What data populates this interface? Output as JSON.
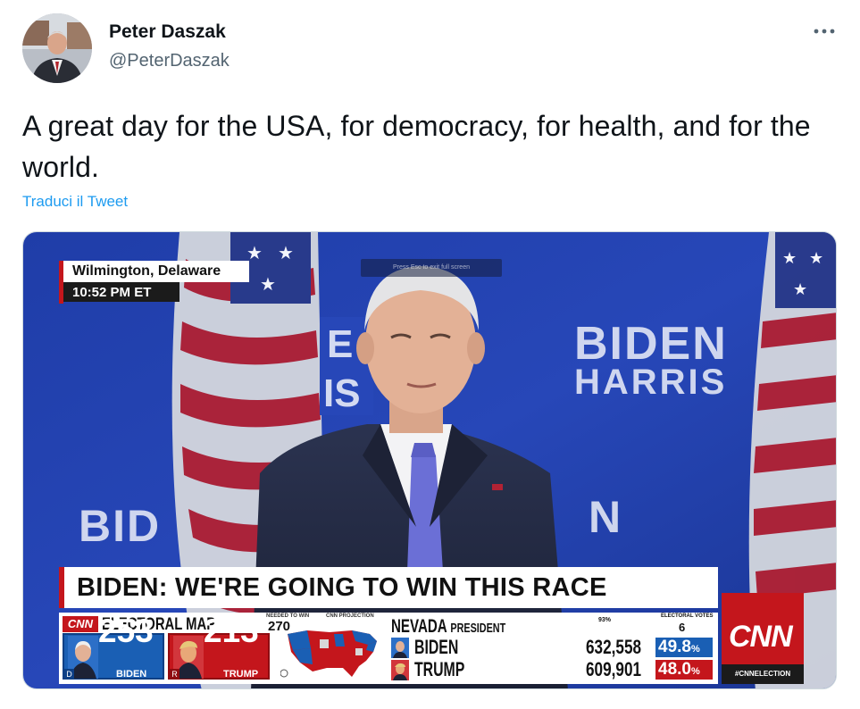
{
  "author": {
    "name": "Peter Daszak",
    "handle": "@PeterDaszak",
    "avatar_icon": "profile-photo"
  },
  "more_icon": "ellipsis-icon",
  "tweet": {
    "text": "A great day for the USA, for democracy, for health, and for the world.",
    "translate_label": "Traduci il Tweet"
  },
  "media": {
    "location": {
      "place": "Wilmington, Delaware",
      "time": "10:52 PM ET"
    },
    "backdrop": {
      "biden": "BIDEN",
      "harris": "HARRIS",
      "left_partial": "BID",
      "mid_partial": "N"
    },
    "ghost_hint": "Press Esc to exit full screen",
    "headline": "BIDEN: WE'RE GOING TO WIN THIS RACE",
    "electoral_map": {
      "brand": "CNN",
      "title": "ELECTORAL MAP",
      "needed_label": "NEEDED TO WIN",
      "needed_value": "270",
      "projection_label": "CNN PROJECTION",
      "biden_ev": "253",
      "trump_ev": "213",
      "biden_label": "BIDEN",
      "trump_label": "TRUMP",
      "party_d": "D",
      "party_r": "R"
    },
    "state_race": {
      "state": "NEVADA",
      "office": "PRESIDENT",
      "reporting": "93%",
      "ev_label": "ELECTORAL VOTES",
      "ev_value": "6",
      "candidates": [
        {
          "name": "BIDEN",
          "votes": "632,558",
          "pct": "49.8",
          "color": "#1a5fb4"
        },
        {
          "name": "TRUMP",
          "votes": "609,901",
          "pct": "48.0",
          "color": "#c4161c"
        }
      ],
      "pct_sign": "%"
    },
    "network": {
      "logo": "CNN",
      "hashtag": "#CNNELECTION"
    }
  }
}
